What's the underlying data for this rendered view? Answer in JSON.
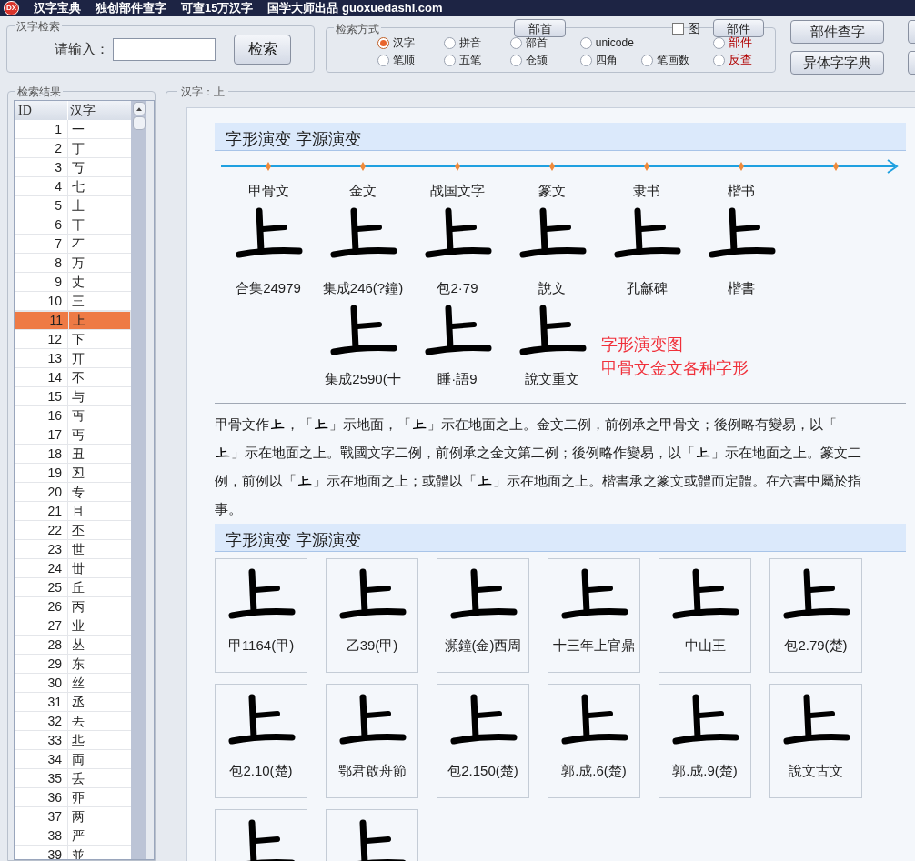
{
  "title_bar": {
    "logo": "DX",
    "segments": [
      "汉字宝典",
      "独创部件查字",
      "可查15万汉字",
      "国学大师出品 guoxuedashi.com"
    ]
  },
  "search_group": {
    "legend": "汉字检索",
    "label": "请输入：",
    "button": "检索"
  },
  "mode_group": {
    "legend": "检索方式",
    "radical_button": "部首",
    "image_checkbox": {
      "label": "图",
      "checked": false
    },
    "component_button": "部件",
    "rows": [
      [
        {
          "label": "汉字",
          "selected": true
        },
        {
          "label": "拼音",
          "selected": false
        },
        {
          "label": "部首",
          "selected": false
        },
        {
          "label": "unicode",
          "selected": false
        },
        {},
        {
          "label": "部件",
          "selected": false,
          "color": "#b00000"
        }
      ],
      [
        {
          "label": "笔顺",
          "selected": false
        },
        {
          "label": "五笔",
          "selected": false
        },
        {
          "label": "仓颉",
          "selected": false
        },
        {
          "label": "四角",
          "selected": false
        },
        {
          "label": "笔画数",
          "selected": false
        },
        {
          "label": "反查",
          "selected": false,
          "color": "#b00000"
        }
      ]
    ]
  },
  "side_buttons": [
    "部件查字",
    "异体字字典"
  ],
  "results": {
    "legend": "检索结果",
    "columns": [
      "ID",
      "汉字"
    ],
    "rows": [
      {
        "id": "1",
        "char": "一",
        "selected": false
      },
      {
        "id": "2",
        "char": "丁",
        "selected": false
      },
      {
        "id": "3",
        "char": "丂",
        "selected": false
      },
      {
        "id": "4",
        "char": "七",
        "selected": false
      },
      {
        "id": "5",
        "char": "丄",
        "selected": false
      },
      {
        "id": "6",
        "char": "丅",
        "selected": false
      },
      {
        "id": "7",
        "char": "丆",
        "selected": false
      },
      {
        "id": "8",
        "char": "万",
        "selected": false
      },
      {
        "id": "9",
        "char": "丈",
        "selected": false
      },
      {
        "id": "10",
        "char": "三",
        "selected": false
      },
      {
        "id": "11",
        "char": "上",
        "selected": true
      },
      {
        "id": "12",
        "char": "下",
        "selected": false
      },
      {
        "id": "13",
        "char": "丌",
        "selected": false
      },
      {
        "id": "14",
        "char": "不",
        "selected": false
      },
      {
        "id": "15",
        "char": "与",
        "selected": false
      },
      {
        "id": "16",
        "char": "丏",
        "selected": false
      },
      {
        "id": "17",
        "char": "丐",
        "selected": false
      },
      {
        "id": "18",
        "char": "丑",
        "selected": false
      },
      {
        "id": "19",
        "char": "丒",
        "selected": false
      },
      {
        "id": "20",
        "char": "专",
        "selected": false
      },
      {
        "id": "21",
        "char": "且",
        "selected": false
      },
      {
        "id": "22",
        "char": "丕",
        "selected": false
      },
      {
        "id": "23",
        "char": "世",
        "selected": false
      },
      {
        "id": "24",
        "char": "丗",
        "selected": false
      },
      {
        "id": "25",
        "char": "丘",
        "selected": false
      },
      {
        "id": "26",
        "char": "丙",
        "selected": false
      },
      {
        "id": "27",
        "char": "业",
        "selected": false
      },
      {
        "id": "28",
        "char": "丛",
        "selected": false
      },
      {
        "id": "29",
        "char": "东",
        "selected": false
      },
      {
        "id": "30",
        "char": "丝",
        "selected": false
      },
      {
        "id": "31",
        "char": "丞",
        "selected": false
      },
      {
        "id": "32",
        "char": "丟",
        "selected": false
      },
      {
        "id": "33",
        "char": "丠",
        "selected": false
      },
      {
        "id": "34",
        "char": "両",
        "selected": false
      },
      {
        "id": "35",
        "char": "丢",
        "selected": false
      },
      {
        "id": "36",
        "char": "丣",
        "selected": false
      },
      {
        "id": "37",
        "char": "两",
        "selected": false
      },
      {
        "id": "38",
        "char": "严",
        "selected": false
      },
      {
        "id": "39",
        "char": "並",
        "selected": false
      }
    ]
  },
  "detail": {
    "legend": "汉字：上",
    "section_1": {
      "heading": "字形演变 字源演变",
      "eras": [
        "甲骨文",
        "金文",
        "战国文字",
        "篆文",
        "隶书",
        "楷书"
      ],
      "forms_row_1": [
        "合集24979",
        "集成246(?鐘)",
        "包2·79",
        "說文",
        "孔龢碑",
        "楷書"
      ],
      "forms_row_2": [
        "集成2590(十",
        "睡·語9",
        "說文重文"
      ],
      "note": [
        "字形演变图",
        "甲骨文金文各种字形"
      ]
    },
    "description": [
      [
        {
          "kind": "text",
          "text": "甲骨文作"
        },
        {
          "kind": "glyph"
        },
        {
          "kind": "text",
          "text": "，「"
        },
        {
          "kind": "glyph"
        },
        {
          "kind": "text",
          "text": "」示地面，「"
        },
        {
          "kind": "glyph"
        },
        {
          "kind": "text",
          "text": "」示在地面之上。金文二例，前例承之甲骨文；後例略有變易，以「"
        }
      ],
      [
        {
          "kind": "glyph"
        },
        {
          "kind": "text",
          "text": "」示在地面之上。戰國文字二例，前例承之金文第二例；後例略作變易，以「"
        },
        {
          "kind": "glyph"
        },
        {
          "kind": "text",
          "text": "」示在地面之上。篆文二"
        }
      ],
      [
        {
          "kind": "text",
          "text": "例，前例以「"
        },
        {
          "kind": "glyph"
        },
        {
          "kind": "text",
          "text": "」示在地面之上；或體以「"
        },
        {
          "kind": "glyph"
        },
        {
          "kind": "text",
          "text": "」示在地面之上。楷書承之篆文或體而定體。在六書中屬於指"
        }
      ],
      [
        {
          "kind": "text",
          "text": "事。"
        }
      ]
    ],
    "section_2": {
      "heading": "字形演变 字源演变",
      "cards": [
        {
          "kind": "captioned",
          "caption": "甲1164(甲)"
        },
        {
          "kind": "captioned",
          "caption": "乙39(甲)"
        },
        {
          "kind": "captioned",
          "caption": "瀕鐘(金)西周"
        },
        {
          "kind": "captioned",
          "caption": "十三年上官鼎"
        },
        {
          "kind": "captioned",
          "caption": "中山王"
        },
        {
          "kind": "captioned",
          "caption": "包2.79(楚)"
        },
        {
          "kind": "captioned",
          "caption": "包2.10(楚)"
        },
        {
          "kind": "captioned",
          "caption": "鄂君啟舟節"
        },
        {
          "kind": "captioned",
          "caption": "包2.150(楚)"
        },
        {
          "kind": "captioned",
          "caption": "郭.成.6(楚)"
        },
        {
          "kind": "captioned",
          "caption": "郭.成.9(楚)"
        },
        {
          "kind": "captioned",
          "caption": "說文古文"
        },
        {
          "kind": "image_only"
        },
        {
          "kind": "image_only"
        }
      ]
    }
  }
}
